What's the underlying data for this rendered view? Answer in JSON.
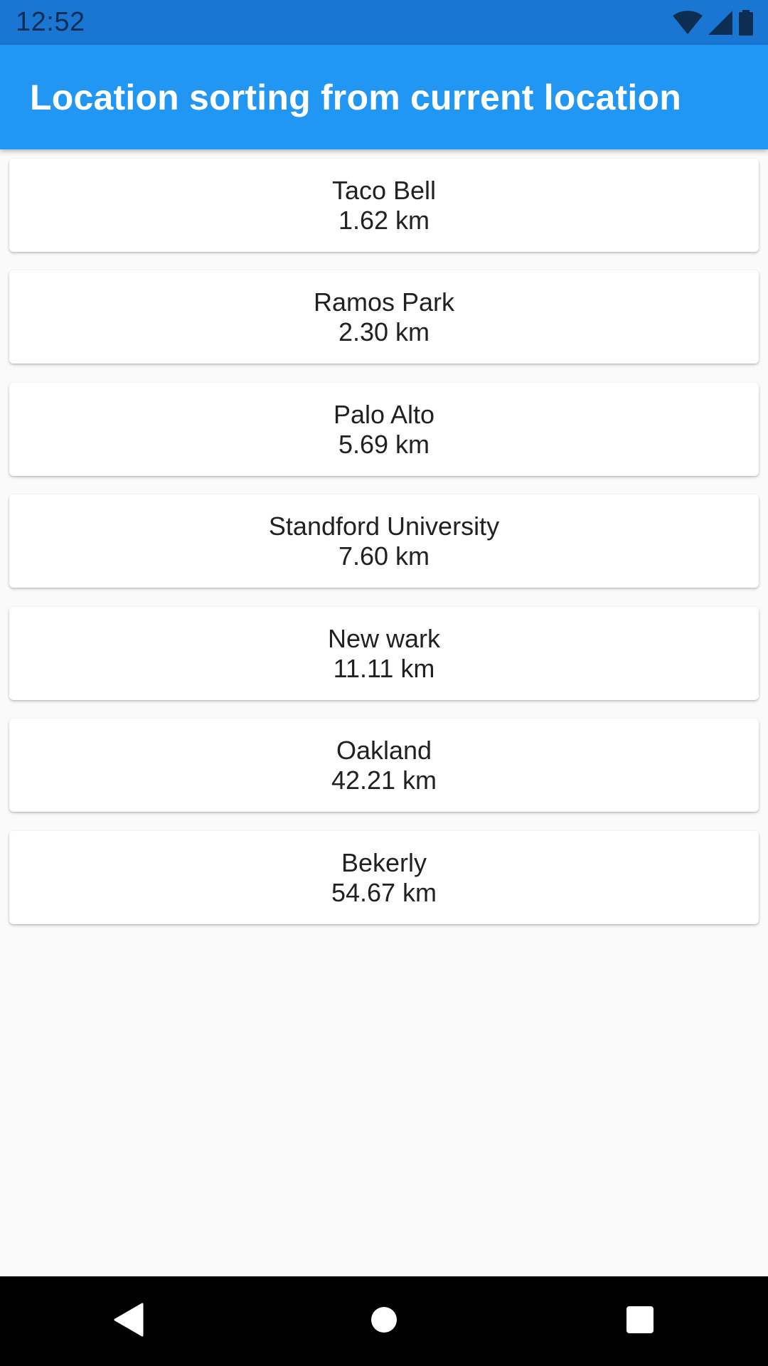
{
  "status_bar": {
    "time": "12:52",
    "icons": [
      "wifi-icon",
      "cell-signal-icon",
      "battery-icon"
    ]
  },
  "app_bar": {
    "title": "Location sorting from current location"
  },
  "locations": [
    {
      "name": "Taco Bell",
      "distance": "1.62 km"
    },
    {
      "name": "Ramos Park",
      "distance": "2.30 km"
    },
    {
      "name": "Palo Alto",
      "distance": "5.69 km"
    },
    {
      "name": "Standford University",
      "distance": "7.60 km"
    },
    {
      "name": "New wark",
      "distance": "11.11 km"
    },
    {
      "name": "Oakland",
      "distance": "42.21 km"
    },
    {
      "name": "Bekerly",
      "distance": "54.67 km"
    }
  ],
  "nav_bar": {
    "buttons": [
      "back-icon",
      "home-icon",
      "recents-icon"
    ]
  },
  "colors": {
    "status_bar": "#1976d2",
    "app_bar": "#2196f3",
    "background": "#fafafa",
    "card": "#ffffff",
    "nav_bar": "#000000"
  }
}
